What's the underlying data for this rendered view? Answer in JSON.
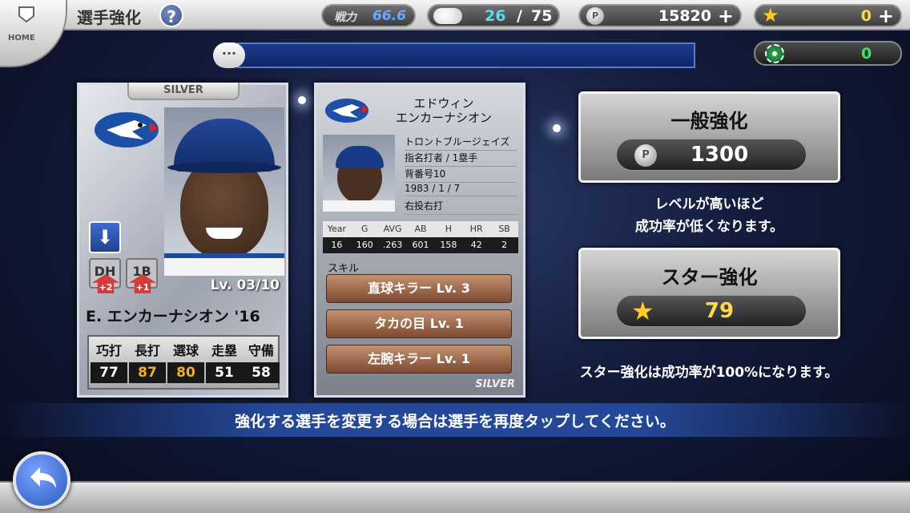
{
  "header": {
    "title": "選手強化",
    "home_label": "HOME",
    "help_icon": "?",
    "power_label": "戦力",
    "power_value": "66.6",
    "stamina_current": "26",
    "stamina_separator": "/",
    "stamina_max": "75",
    "coins": "15820",
    "stars": "0",
    "chips": "0"
  },
  "message": "",
  "player_card": {
    "rank": "SILVER",
    "level": "Lv. 03/10",
    "name": "E. エンカーナシオン '16",
    "positions": [
      {
        "label": "DH",
        "boost": "+2"
      },
      {
        "label": "1B",
        "boost": "+1"
      }
    ],
    "stats": [
      {
        "label": "巧打",
        "value": "77",
        "highlight": false
      },
      {
        "label": "長打",
        "value": "87",
        "highlight": true
      },
      {
        "label": "選球",
        "value": "80",
        "highlight": true
      },
      {
        "label": "走塁",
        "value": "51",
        "highlight": false
      },
      {
        "label": "守備",
        "value": "58",
        "highlight": false
      }
    ]
  },
  "detail_card": {
    "kana_first": "エドウィン",
    "kana_last": "エンカーナシオン",
    "team": "トロントブルージェイズ",
    "position": "指名打者 / 1塁手",
    "number": "背番号10",
    "birthdate": "1983 / 1 / 7",
    "handedness": "右投右打",
    "record_headers": [
      "Year",
      "G",
      "AVG",
      "AB",
      "H",
      "HR",
      "SB"
    ],
    "record_values": [
      "16",
      "160",
      ".263",
      "601",
      "158",
      "42",
      "2"
    ],
    "skills_title": "スキル",
    "skills": [
      "直球キラー Lv. 3",
      "タカの目 Lv. 1",
      "左腕キラー Lv. 1"
    ],
    "rank": "SILVER"
  },
  "general_enhance": {
    "title": "一般強化",
    "cost": "1300",
    "note_line1": "レベルが高いほど",
    "note_line2": "成功率が低くなります。"
  },
  "star_enhance": {
    "title": "スター強化",
    "cost": "79",
    "note": "スター強化は成功率が100%になります。"
  },
  "bottom_message": "強化する選手を変更する場合は選手を再度タップしてください。",
  "colors": {
    "accent_blue": "#2a58c0",
    "gold": "#ffd84a",
    "chip_green": "#44dd66"
  }
}
